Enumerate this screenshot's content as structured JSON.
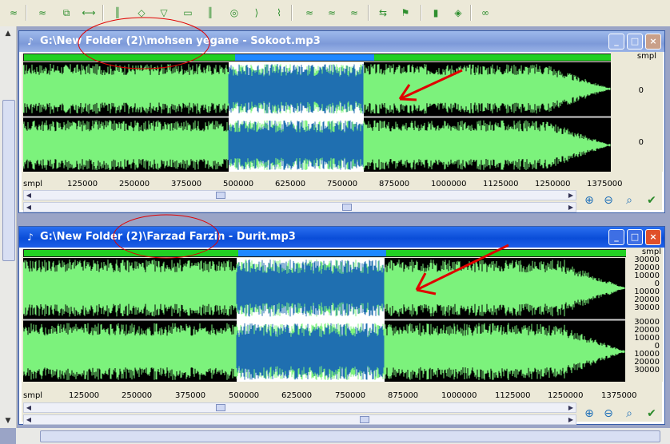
{
  "toolbar": {
    "icons": [
      "waveform-icon",
      "waveform-icon",
      "cut-icon",
      "range-icon",
      "waveform-icon",
      "amplify-icon",
      "fade-icon",
      "normalize-icon",
      "waveform-icon",
      "echo-icon",
      "reverse-icon",
      "effect-icon",
      "waveform-icon",
      "waveform-icon",
      "waveform-icon",
      "tempo-icon",
      "marker-icon",
      "split-icon",
      "pitch-icon",
      "chain-icon"
    ]
  },
  "windows": [
    {
      "title": "G:\\New Folder (2)\\mohsen yegane - Sokoot.mp3",
      "active": false,
      "unit_label": "smpl",
      "x_unit_label": "smpl",
      "x_ticks": [
        "125000",
        "250000",
        "375000",
        "500000",
        "625000",
        "750000",
        "875000",
        "1000000",
        "1125000",
        "1250000",
        "1375000"
      ],
      "y_ticks_top": [
        "0"
      ],
      "y_ticks_bottom": [
        "0"
      ],
      "selection": {
        "start_fraction": 0.35,
        "end_fraction": 0.58
      }
    },
    {
      "title": "G:\\New Folder (2)\\Farzad Farzin - Durit.mp3",
      "active": true,
      "unit_label": "smpl",
      "x_unit_label": "smpl",
      "x_ticks": [
        "125000",
        "250000",
        "375000",
        "500000",
        "625000",
        "750000",
        "875000",
        "1000000",
        "1125000",
        "1250000",
        "1375000"
      ],
      "y_ticks_top": [
        "30000",
        "20000",
        "10000",
        "0",
        "10000",
        "20000",
        "30000"
      ],
      "y_ticks_bottom": [
        "30000",
        "20000",
        "10000",
        "0",
        "10000",
        "20000",
        "30000"
      ],
      "selection": {
        "start_fraction": 0.355,
        "end_fraction": 0.6
      }
    }
  ],
  "colors": {
    "wave": "#7cf27c",
    "selected_wave": "#1f6fb0",
    "selection_bg": "#ffffff",
    "background": "#000000",
    "annotation": "#e00000"
  },
  "window_buttons": {
    "minimize": "_",
    "maximize": "□",
    "close": "×"
  },
  "scroll_arrows": {
    "up": "▲",
    "down": "▼",
    "left": "◀",
    "right": "▶"
  }
}
